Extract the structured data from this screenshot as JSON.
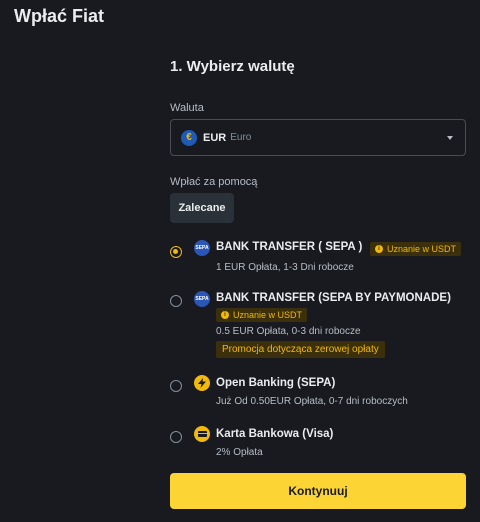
{
  "page": {
    "title": "Wpłać Fiat"
  },
  "step": {
    "title": "1. Wybierz walutę"
  },
  "currency": {
    "label": "Waluta",
    "symbol": "€",
    "code": "EUR",
    "name": "Euro"
  },
  "deposit_via": {
    "label": "Wpłać za pomocą",
    "tab": "Zalecane"
  },
  "methods": [
    {
      "name": "BANK TRANSFER ( SEPA )",
      "icon": "sepa-icon",
      "icon_text": "SEPA",
      "badge": "Uznanie w USDT",
      "details": "1 EUR Opłata, 1-3 Dni robocze",
      "selected": true
    },
    {
      "name": "BANK TRANSFER (SEPA BY PAYMONADE)",
      "icon": "sepa-icon",
      "icon_text": "SEPA",
      "badge": "Uznanie w USDT",
      "details": "0.5 EUR Opłata, 0-3 dni robocze",
      "promo": "Promocja dotycząca zerowej opłaty",
      "selected": false
    },
    {
      "name": "Open Banking (SEPA)",
      "icon": "bolt-icon",
      "details": "Już Od 0.50EUR Opłata, 0-7 dni roboczych",
      "selected": false
    },
    {
      "name": "Karta Bankowa (Visa)",
      "icon": "card-icon",
      "details": "2% Opłata",
      "selected": false
    }
  ],
  "continue_button": "Kontynuuj",
  "colors": {
    "background": "#181a20",
    "accent": "#fcd535",
    "badge_bg": "#3c2f0c",
    "badge_text": "#f0b90b"
  }
}
